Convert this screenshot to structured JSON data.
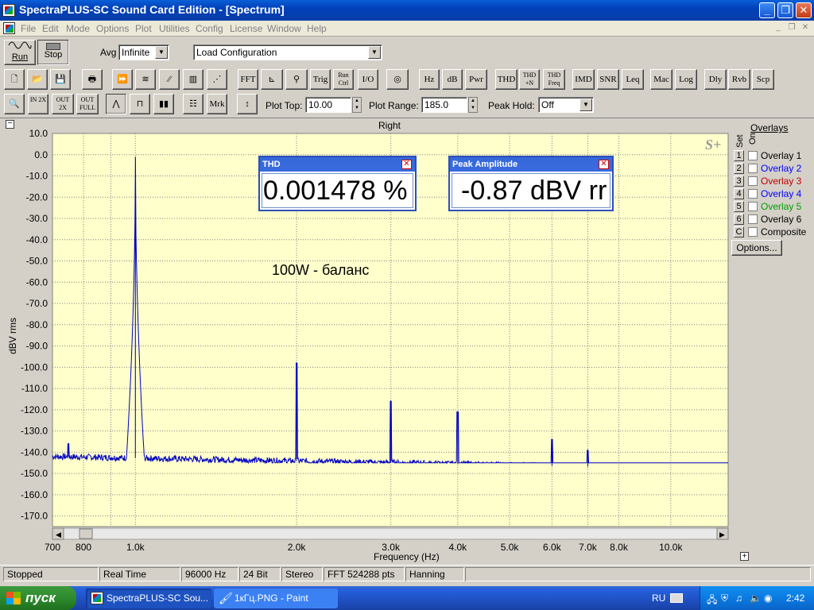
{
  "window": {
    "title": "SpectraPLUS-SC Sound Card Edition - [Spectrum]",
    "controls": {
      "minimize": "_",
      "restore": "❐",
      "close": "✕"
    }
  },
  "menu": [
    "File",
    "Edit",
    "Mode",
    "Options",
    "Plot",
    "Utilities",
    "Config",
    "License",
    "Window",
    "Help"
  ],
  "toolbar1": {
    "run_label": "Run",
    "stop_label": "Stop",
    "avg_label": "Avg",
    "avg_value": "Infinite",
    "config_value": "Load Configuration"
  },
  "toolbar2": {
    "fft": "FFT",
    "trig": "Trig",
    "run_ctrl": "Run Ctrl",
    "io": "I/O",
    "hz": "Hz",
    "db": "dB",
    "pwr": "Pwr",
    "thd": "THD",
    "thd_n": "THD +N",
    "thd_freq": "THD Freq",
    "imd": "IMD",
    "snr": "SNR",
    "leq": "Leq",
    "mac": "Mac",
    "log": "Log",
    "dly": "Dly",
    "rvb": "Rvb",
    "scp": "Scp"
  },
  "toolbar3": {
    "zoom_in": "IN 2X",
    "zoom_out": "OUT 2X",
    "zoom_full": "OUT FULL",
    "mrk": "Mrk",
    "plot_top_label": "Plot Top:",
    "plot_top_value": "10.00",
    "plot_range_label": "Plot Range:",
    "plot_range_value": "185.0",
    "peak_hold_label": "Peak Hold:",
    "peak_hold_value": "Off"
  },
  "plot": {
    "channel_title": "Right",
    "logo": "S+",
    "annotation": "100W - баланс",
    "collapse_icon": "⊟",
    "expand_icon": "⊞"
  },
  "chart_data": {
    "type": "line",
    "title": "Right",
    "xlabel": "Frequency (Hz)",
    "ylabel": "dBV rms",
    "x_scale": "log",
    "xlim": [
      700,
      12800
    ],
    "ylim": [
      -175,
      10
    ],
    "grid": true,
    "y_ticks": [
      "10.0",
      "0.0",
      "-10.0",
      "-20.0",
      "-30.0",
      "-40.0",
      "-50.0",
      "-60.0",
      "-70.0",
      "-80.0",
      "-90.0",
      "-100.0",
      "-110.0",
      "-120.0",
      "-130.0",
      "-140.0",
      "-150.0",
      "-160.0",
      "-170.0"
    ],
    "x_ticks": [
      {
        "value": 700,
        "label": "700"
      },
      {
        "value": 800,
        "label": "800"
      },
      {
        "value": 1000,
        "label": "1.0k"
      },
      {
        "value": 2000,
        "label": "2.0k"
      },
      {
        "value": 3000,
        "label": "3.0k"
      },
      {
        "value": 4000,
        "label": "4.0k"
      },
      {
        "value": 5000,
        "label": "5.0k"
      },
      {
        "value": 6000,
        "label": "6.0k"
      },
      {
        "value": 7000,
        "label": "7.0k"
      },
      {
        "value": 8000,
        "label": "8.0k"
      },
      {
        "value": 10000,
        "label": "10.0k"
      }
    ],
    "x_minor_ticks": [
      900
    ],
    "noise_floor": {
      "start_db": -142,
      "end_db": -148
    },
    "peaks": [
      {
        "freq": 750,
        "db": -136
      },
      {
        "freq": 1000,
        "db": -1
      },
      {
        "freq": 2000,
        "db": -98
      },
      {
        "freq": 3000,
        "db": -116
      },
      {
        "freq": 4000,
        "db": -121
      },
      {
        "freq": 6000,
        "db": -134
      },
      {
        "freq": 7000,
        "db": -139
      }
    ],
    "line_color": "#0000c0"
  },
  "meters": {
    "thd": {
      "title": "THD",
      "value": "0.001478 %"
    },
    "peak": {
      "title": "Peak Amplitude",
      "value": "-0.87 dBV rr"
    }
  },
  "overlays": {
    "title": "Overlays",
    "set_label": "Set",
    "on_label": "On",
    "items": [
      {
        "num": "1",
        "label": "Overlay 1",
        "color": "#000000"
      },
      {
        "num": "2",
        "label": "Overlay 2",
        "color": "#0000ff"
      },
      {
        "num": "3",
        "label": "Overlay 3",
        "color": "#c00000"
      },
      {
        "num": "4",
        "label": "Overlay 4",
        "color": "#0000ff"
      },
      {
        "num": "5",
        "label": "Overlay 5",
        "color": "#00a000"
      },
      {
        "num": "6",
        "label": "Overlay 6",
        "color": "#000000"
      },
      {
        "num": "C",
        "label": "Composite",
        "color": "#000000"
      }
    ],
    "options_button": "Options..."
  },
  "status": {
    "state": "Stopped",
    "mode": "Real Time",
    "rate": "96000 Hz",
    "bits": "24 Bit",
    "channels": "Stereo",
    "fft": "FFT 524288 pts",
    "window": "Hanning"
  },
  "taskbar": {
    "start": "пуск",
    "tasks": [
      "SpectraPLUS-SC Sou...",
      "1кГц.PNG - Paint"
    ],
    "lang": "RU",
    "clock": "2:42"
  }
}
